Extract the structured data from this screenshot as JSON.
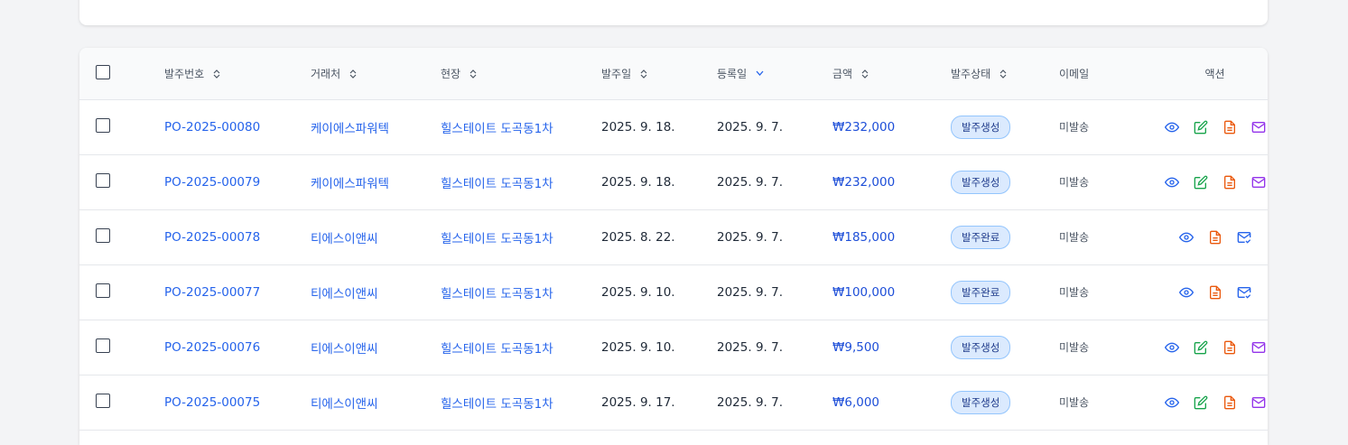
{
  "table": {
    "headers": {
      "po_number": "발주번호",
      "vendor": "거래처",
      "site": "현장",
      "order_date": "발주일",
      "reg_date": "등록일",
      "amount": "금액",
      "status": "발주상태",
      "email": "이메일",
      "actions": "액션"
    },
    "rows": [
      {
        "po": "PO-2025-00080",
        "vendor": "케이에스파워텍",
        "site": "힐스테이트 도곡동1차",
        "order_date": "2025. 9. 18.",
        "reg_date": "2025. 9. 7.",
        "amount": "₩232,000",
        "status": "발주생성",
        "email": "미발송"
      },
      {
        "po": "PO-2025-00079",
        "vendor": "케이에스파워텍",
        "site": "힐스테이트 도곡동1차",
        "order_date": "2025. 9. 18.",
        "reg_date": "2025. 9. 7.",
        "amount": "₩232,000",
        "status": "발주생성",
        "email": "미발송"
      },
      {
        "po": "PO-2025-00078",
        "vendor": "티에스이앤씨",
        "site": "힐스테이트 도곡동1차",
        "order_date": "2025. 8. 22.",
        "reg_date": "2025. 9. 7.",
        "amount": "₩185,000",
        "status": "발주완료",
        "email": "미발송"
      },
      {
        "po": "PO-2025-00077",
        "vendor": "티에스이앤씨",
        "site": "힐스테이트 도곡동1차",
        "order_date": "2025. 9. 10.",
        "reg_date": "2025. 9. 7.",
        "amount": "₩100,000",
        "status": "발주완료",
        "email": "미발송"
      },
      {
        "po": "PO-2025-00076",
        "vendor": "티에스이앤씨",
        "site": "힐스테이트 도곡동1차",
        "order_date": "2025. 9. 10.",
        "reg_date": "2025. 9. 7.",
        "amount": "₩9,500",
        "status": "발주생성",
        "email": "미발송"
      },
      {
        "po": "PO-2025-00075",
        "vendor": "티에스이앤씨",
        "site": "힐스테이트 도곡동1차",
        "order_date": "2025. 9. 17.",
        "reg_date": "2025. 9. 7.",
        "amount": "₩6,000",
        "status": "발주생성",
        "email": "미발송"
      }
    ]
  },
  "icons": {
    "view": "eye-icon",
    "edit": "edit-icon",
    "pdf": "document-icon",
    "email": "mail-icon",
    "email_sent": "mail-check-icon"
  },
  "colors": {
    "link": "#2563eb",
    "amount": "#1d4ed8",
    "badge_bg": "#dbeafe",
    "view_icon": "#2563eb",
    "edit_icon": "#16a34a",
    "pdf_icon": "#ea580c",
    "mail_icon": "#9333ea"
  }
}
